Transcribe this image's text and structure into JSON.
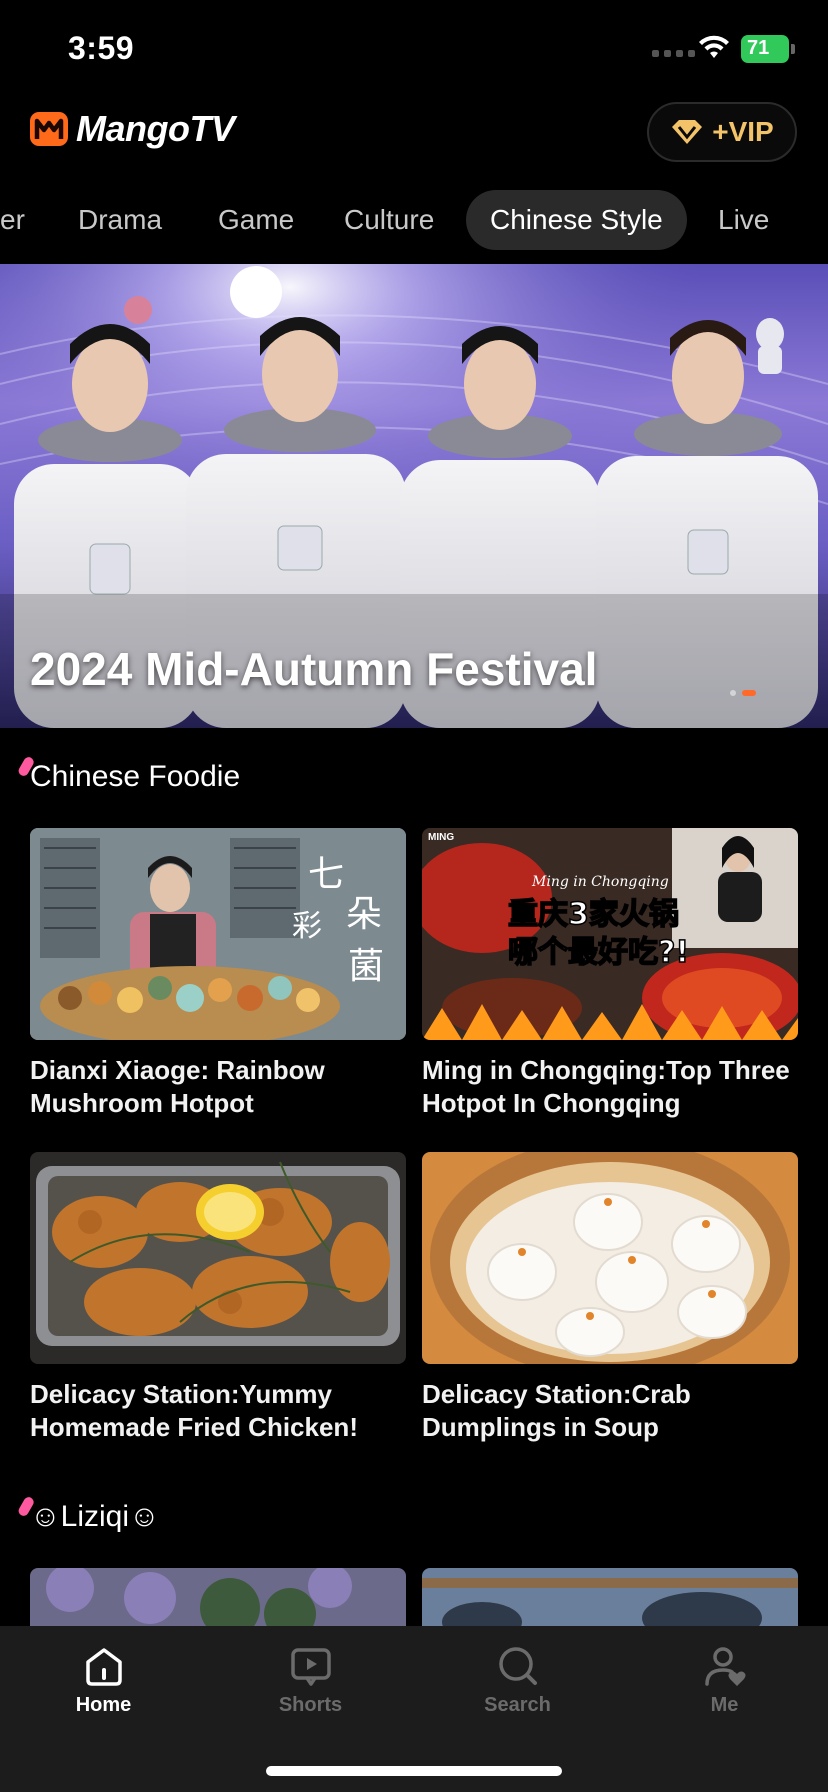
{
  "status_bar": {
    "time": "3:59",
    "battery": "71"
  },
  "header": {
    "logo_text": "MangoTV",
    "vip_label": "+VIP"
  },
  "tabs": [
    {
      "label": "er",
      "active": false
    },
    {
      "label": "Drama",
      "active": false
    },
    {
      "label": "Game",
      "active": false
    },
    {
      "label": "Culture",
      "active": false
    },
    {
      "label": "Chinese Style",
      "active": true
    },
    {
      "label": "Live",
      "active": false
    }
  ],
  "hero": {
    "title": "2024 Mid-Autumn Festival",
    "slide_count": 2,
    "active_slide": 2
  },
  "sections": [
    {
      "title": "Chinese Foodie",
      "items": [
        {
          "title": "Dianxi Xiaoge: Rainbow Mushroom Hotpot",
          "thumb_text": "七彩菌",
          "thumb_text2": "朵"
        },
        {
          "title": "Ming in Chongqing:Top Three Hotpot In Chongqing",
          "thumb_text": "重庆3家火锅",
          "thumb_text2": "哪个最好吃?!",
          "thumb_tag": "MING",
          "thumb_script": "Ming in Chongqing"
        },
        {
          "title": "Delicacy Station:Yummy Homemade Fried Chicken!"
        },
        {
          "title": "Delicacy Station:Crab Dumplings in Soup"
        }
      ]
    },
    {
      "title": "☺Liziqi☺"
    }
  ],
  "bottom_nav": [
    {
      "label": "Home",
      "icon": "home-icon",
      "active": true
    },
    {
      "label": "Shorts",
      "icon": "play-box-icon",
      "active": false
    },
    {
      "label": "Search",
      "icon": "search-icon",
      "active": false
    },
    {
      "label": "Me",
      "icon": "user-heart-icon",
      "active": false
    }
  ],
  "colors": {
    "accent_orange": "#ff6a2b",
    "vip_gold": "#f3c36a",
    "battery_green": "#31c95a"
  }
}
